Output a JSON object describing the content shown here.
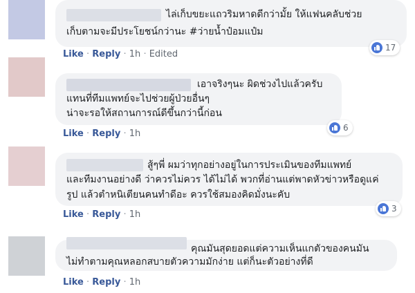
{
  "actions": {
    "like": "Like",
    "reply": "Reply",
    "dot": "·",
    "edited": "Edited"
  },
  "comments": [
    {
      "lines": [
        "ไล่เก็บขยะแถวริมหาดดีกว่ามั้ย ให้แฟนคลับช่วย",
        "เก็บตามจะมีประโยชน์กว่านะ #ว่ายน้ำป๋อมแป๋ม"
      ],
      "time": "1h",
      "reactions": "17"
    },
    {
      "lines": [
        "เอาจริงๆนะ ผิดช่วงไปแล้วครับ",
        "แทนที่ทีมแพทย์จะไปช่วยผู้ป่วยอื่นๆ",
        "น่าจะรอให้สถานการณ์ดีขึ้นกว่านี้ก่อน"
      ],
      "time": "1h",
      "reactions": "6"
    },
    {
      "lines": [
        "สู้ๆพี่ ผมว่าทุกอย่างอยู่ในการประเมินของทีมแพทย์",
        "และทีมงานอย่างดี ว่าควรไม่ควร ได้ไม่ได้ พวกที่อ่านแต่พาดหัวข่าวหรือดูแค่",
        "รูป แล้วตำหนิเตียนคนทำดีอะ ควรใช้สมองคิดมั่งนะคับ"
      ],
      "time": "1h",
      "reactions": "3"
    },
    {
      "lines": [
        "คุณมันสุดยอดแต่ความเห็นแกตัวของคนมัน",
        "ไม่ทำตามคุณหลอกสบายตัวความมักง่าย แต่ก็นะตัวอย่างที่ดี"
      ],
      "time": "1h"
    }
  ]
}
